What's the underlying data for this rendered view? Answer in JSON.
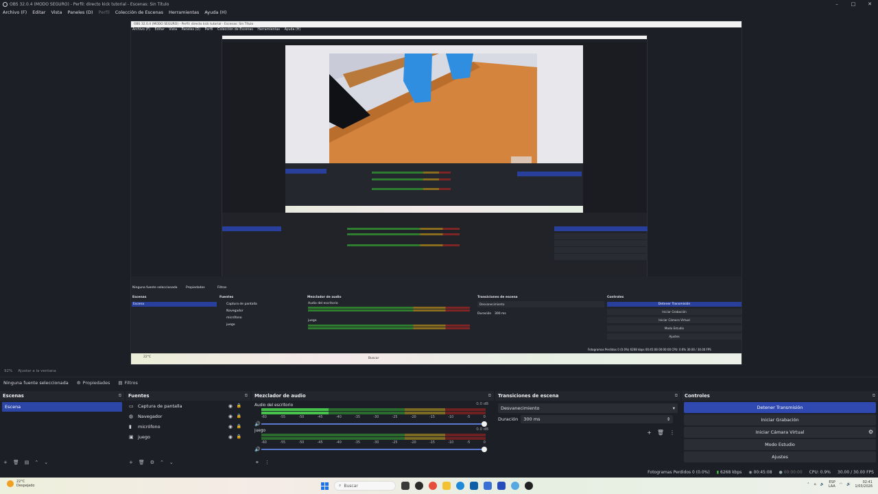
{
  "window": {
    "title": "OBS 32.0.4 (MODO SEGURO) - Perfil: directo kick tutorial - Escenas: Sin Título",
    "minimize": "–",
    "maximize": "□",
    "close": "✕"
  },
  "menu": [
    "Archivo (F)",
    "Editar",
    "Vista",
    "Paneles (D)",
    "Perfil",
    "Colección de Escenas",
    "Herramientas",
    "Ayuda (H)"
  ],
  "zoom": {
    "percent": "92%",
    "fit": "Ajustar a la ventana"
  },
  "inner": {
    "title": "OBS 32.0.4 (MODO SEGURO) - Perfil: directo kick tutorial - Escenas: Sin Título",
    "menu": [
      "Archivo (F)",
      "Editar",
      "Vista",
      "Paneles (D)",
      "Perfil",
      "Colección de Escenas",
      "Herramientas",
      "Ayuda (H)"
    ],
    "status": "Ninguna fuente seleccionada",
    "props": "Propiedades",
    "filters": "Filtros",
    "docks": [
      "Escenas",
      "Fuentes",
      "Mezclador de audio",
      "Transiciones de escena",
      "Controles"
    ],
    "scene": "Escena",
    "sources": [
      "Captura de pantalla",
      "Navegador",
      "micrófono",
      "juego"
    ],
    "channels": [
      "Audio del escritorio",
      "juego"
    ],
    "transition": "Desvanecimiento",
    "duration_label": "Duración",
    "duration": "300 ms",
    "controls": [
      "Detener Transmisión",
      "Iniciar Grabación",
      "Iniciar Cámara Virtual",
      "Modo Estudio",
      "Ajustes"
    ],
    "statusbar": "Fotogramas Perdidos 0 (0.0%)   6268 kbps   00:45:08   00:00:00   CPU: 0.6%   30.00 / 30.00 FPS",
    "weather": "22°C",
    "search": "Buscar"
  },
  "toolbar": {
    "no_source": "Ninguna fuente seleccionada",
    "properties": "Propiedades",
    "filters": "Filtros"
  },
  "scenes": {
    "title": "Escenas",
    "items": [
      "Escena"
    ]
  },
  "sources": {
    "title": "Fuentes",
    "items": [
      {
        "name": "Captura de pantalla",
        "icon": "monitor-icon"
      },
      {
        "name": "Navegador",
        "icon": "globe-icon"
      },
      {
        "name": "micrófono",
        "icon": "microphone-icon"
      },
      {
        "name": "juego",
        "icon": "window-icon"
      }
    ]
  },
  "mixer": {
    "title": "Mezclador de audio",
    "channels": [
      {
        "name": "Audio del escritorio",
        "db": "0.0 dB",
        "level": 0.3
      },
      {
        "name": "juego",
        "db": "0.0 dB",
        "level": 0.0
      }
    ],
    "ticks": [
      "-60",
      "-55",
      "-50",
      "-45",
      "-40",
      "-35",
      "-30",
      "-25",
      "-20",
      "-15",
      "-10",
      "-5",
      "0"
    ]
  },
  "transitions": {
    "title": "Transiciones de escena",
    "selected": "Desvanecimiento",
    "duration_label": "Duración",
    "duration": "300 ms"
  },
  "controls": {
    "title": "Controles",
    "stop_stream": "Detener Transmisión",
    "start_rec": "Iniciar Grabación",
    "virtual_cam": "Iniciar Cámara Virtual",
    "studio": "Modo Estudio",
    "settings": "Ajustes"
  },
  "status": {
    "dropped": "Fotogramas Perdidos 0 (0.0%)",
    "bitrate": "6268 kbps",
    "live_time": "00:45:08",
    "rec_time": "00:00:00",
    "cpu": "CPU: 0.9%",
    "fps": "30.00 / 30.00 FPS"
  },
  "taskbar": {
    "temp": "22°C",
    "weather": "Despejado",
    "search": "Buscar",
    "lang1": "ESP",
    "lang2": "LAA",
    "time": "02:41",
    "date": "1/03/2026"
  },
  "colors": {
    "accent": "#2f49b0",
    "bg": "#1d1f26",
    "meter_green": "#45c34a"
  }
}
